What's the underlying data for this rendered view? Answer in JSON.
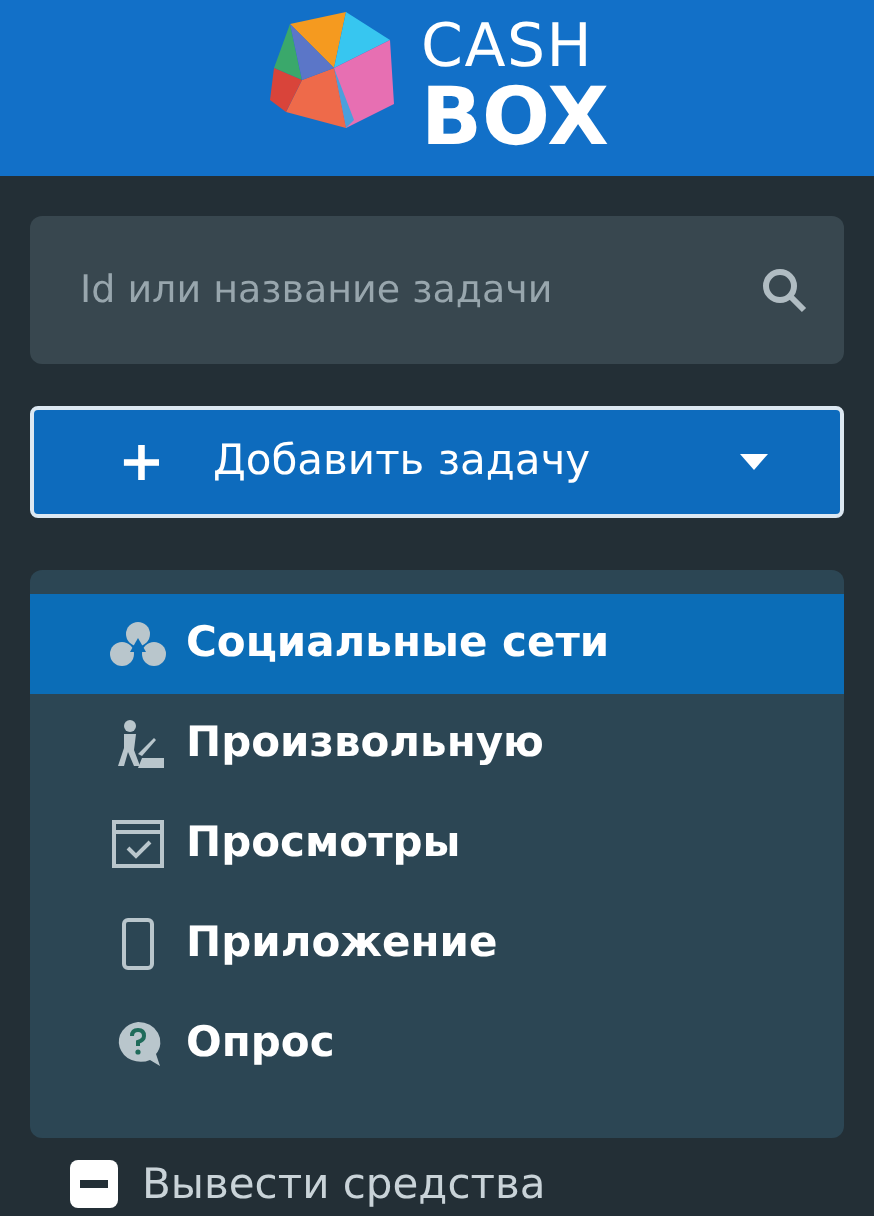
{
  "logo": {
    "line_1": "CASH",
    "line_2": "BOX"
  },
  "search": {
    "placeholder": "Id или название задачи"
  },
  "add_button": {
    "plus": "+",
    "label": "Добавить задачу"
  },
  "menu": [
    {
      "kind": "social",
      "label": "Социальные сети",
      "selected": true
    },
    {
      "kind": "custom",
      "label": "Произвольную",
      "selected": false
    },
    {
      "kind": "views",
      "label": "Просмотры",
      "selected": false
    },
    {
      "kind": "app",
      "label": "Приложение",
      "selected": false
    },
    {
      "kind": "poll",
      "label": "Опрос",
      "selected": false
    }
  ],
  "withdraw": {
    "label": "Вывести средства"
  }
}
